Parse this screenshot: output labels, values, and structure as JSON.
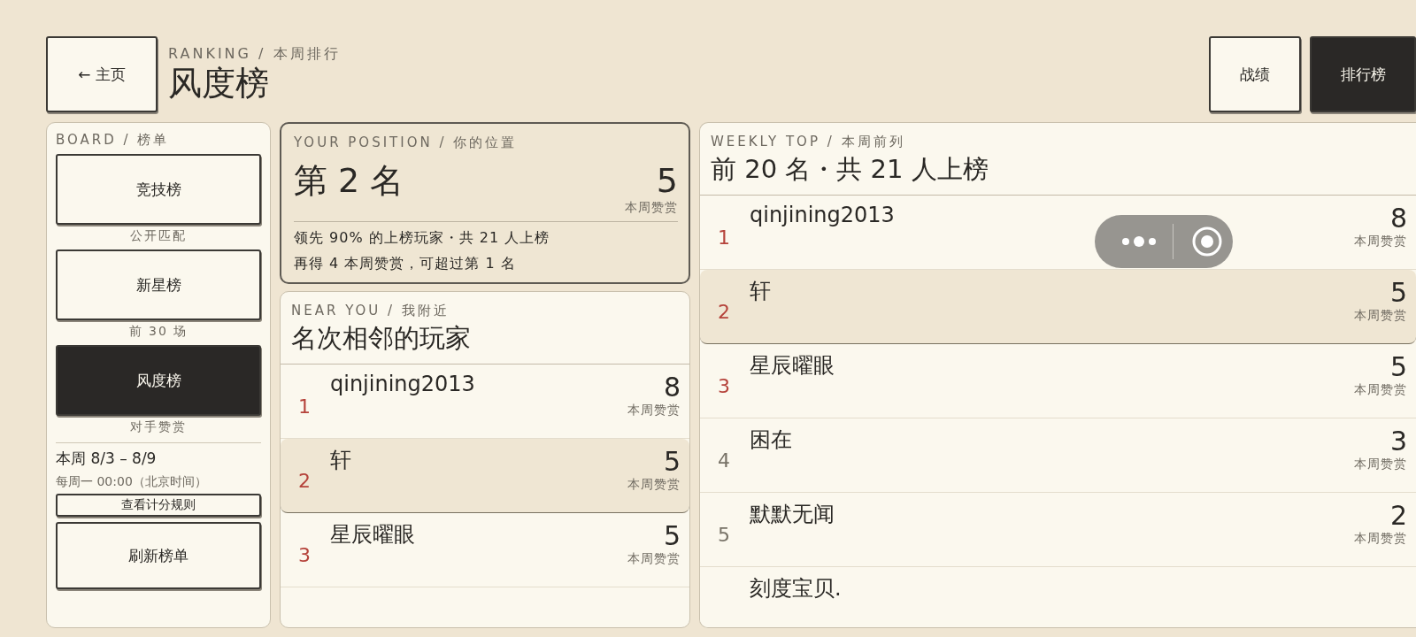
{
  "header": {
    "back_button": "← 主页",
    "eyebrow": "RANKING / 本周排行",
    "title": "风度榜",
    "nav": [
      {
        "label": "战绩",
        "selected": false
      },
      {
        "label": "排行榜",
        "selected": true
      }
    ]
  },
  "board": {
    "eyebrow": "BOARD / 榜单",
    "boards": [
      {
        "label": "竞技榜",
        "caption": "公开匹配",
        "selected": false
      },
      {
        "label": "新星榜",
        "caption": "前 30 场",
        "selected": false
      },
      {
        "label": "风度榜",
        "caption": "对手赞赏",
        "selected": true
      }
    ],
    "week": "本周 8/3 – 8/9",
    "reset": "每周一 00:00（北京时间）",
    "rules_button": "查看计分规则",
    "refresh_button": "刷新榜单"
  },
  "position": {
    "eyebrow": "YOUR POSITION / 你的位置",
    "rank": "第 2 名",
    "score": "5",
    "score_label": "本周赞赏",
    "lines": [
      "领先 90% 的上榜玩家・共 21 人上榜",
      "再得 4 本周赞赏，可超过第 1 名"
    ]
  },
  "near": {
    "eyebrow": "NEAR YOU / 我附近",
    "title": "名次相邻的玩家",
    "rows": [
      {
        "rank": "1",
        "name": "qinjining2013",
        "score": "8",
        "score_label": "本周赞赏",
        "selected": false,
        "color": "#b5433b"
      },
      {
        "rank": "2",
        "name": "轩",
        "score": "5",
        "score_label": "本周赞赏",
        "selected": true,
        "color": "#b5433b"
      },
      {
        "rank": "3",
        "name": "星辰曜眼",
        "score": "5",
        "score_label": "本周赞赏",
        "selected": false,
        "color": "#b5433b"
      }
    ]
  },
  "weekly": {
    "eyebrow": "WEEKLY TOP / 本周前列",
    "title": "前 20 名・共 21 人上榜",
    "rows": [
      {
        "rank": "1",
        "name": "qinjining2013",
        "score": "8",
        "score_label": "本周赞赏",
        "selected": false,
        "color": "#b5433b"
      },
      {
        "rank": "2",
        "name": "轩",
        "score": "5",
        "score_label": "本周赞赏",
        "selected": true,
        "color": "#b5433b"
      },
      {
        "rank": "3",
        "name": "星辰曜眼",
        "score": "5",
        "score_label": "本周赞赏",
        "selected": false,
        "color": "#b5433b"
      },
      {
        "rank": "4",
        "name": "困在",
        "score": "3",
        "score_label": "本周赞赏",
        "selected": false,
        "color": "#777267"
      },
      {
        "rank": "5",
        "name": "默默无闻",
        "score": "2",
        "score_label": "本周赞赏",
        "selected": false,
        "color": "#777267"
      },
      {
        "name": "刻度宝贝.",
        "selected": false
      }
    ]
  }
}
